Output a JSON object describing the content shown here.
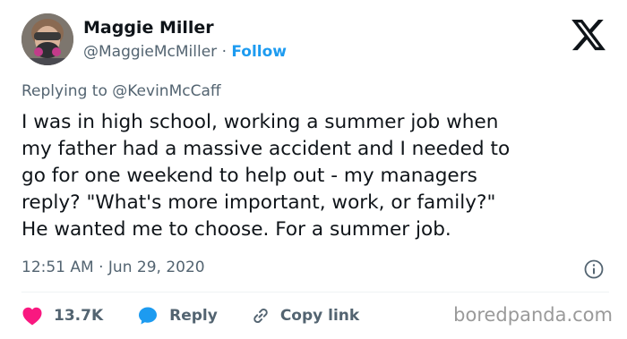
{
  "author": {
    "name": "Maggie Miller",
    "handle": "@MaggieMcMiller",
    "separator": "·",
    "follow_label": "Follow",
    "avatar_icon": "avatar-photo-gas-mask"
  },
  "platform": {
    "logo_icon": "x-logo"
  },
  "reply_context": {
    "prefix": "Replying to",
    "mention": "@KevinMcCaff"
  },
  "tweet": {
    "lines": [
      "I was in high school, working a summer job when",
      "my father had a massive accident and I needed to",
      "go for one weekend to help out - my managers",
      "reply? \"What's more important, work, or family?\"",
      "He wanted me to choose. For a summer job."
    ],
    "time": "12:51 AM",
    "separator": "·",
    "date": "Jun 29, 2020",
    "info_icon": "info-icon"
  },
  "actions": {
    "like_icon": "heart-icon",
    "like_count": "13.7K",
    "reply_icon": "speech-bubble-icon",
    "reply_label": "Reply",
    "copy_icon": "link-icon",
    "copy_label": "Copy link"
  },
  "watermark": {
    "text": "boredpanda.com"
  },
  "colors": {
    "text": "#0f1419",
    "secondary": "#536471",
    "accent": "#1d9bf0",
    "like": "#f91880",
    "watermark": "#9a9a9a"
  }
}
